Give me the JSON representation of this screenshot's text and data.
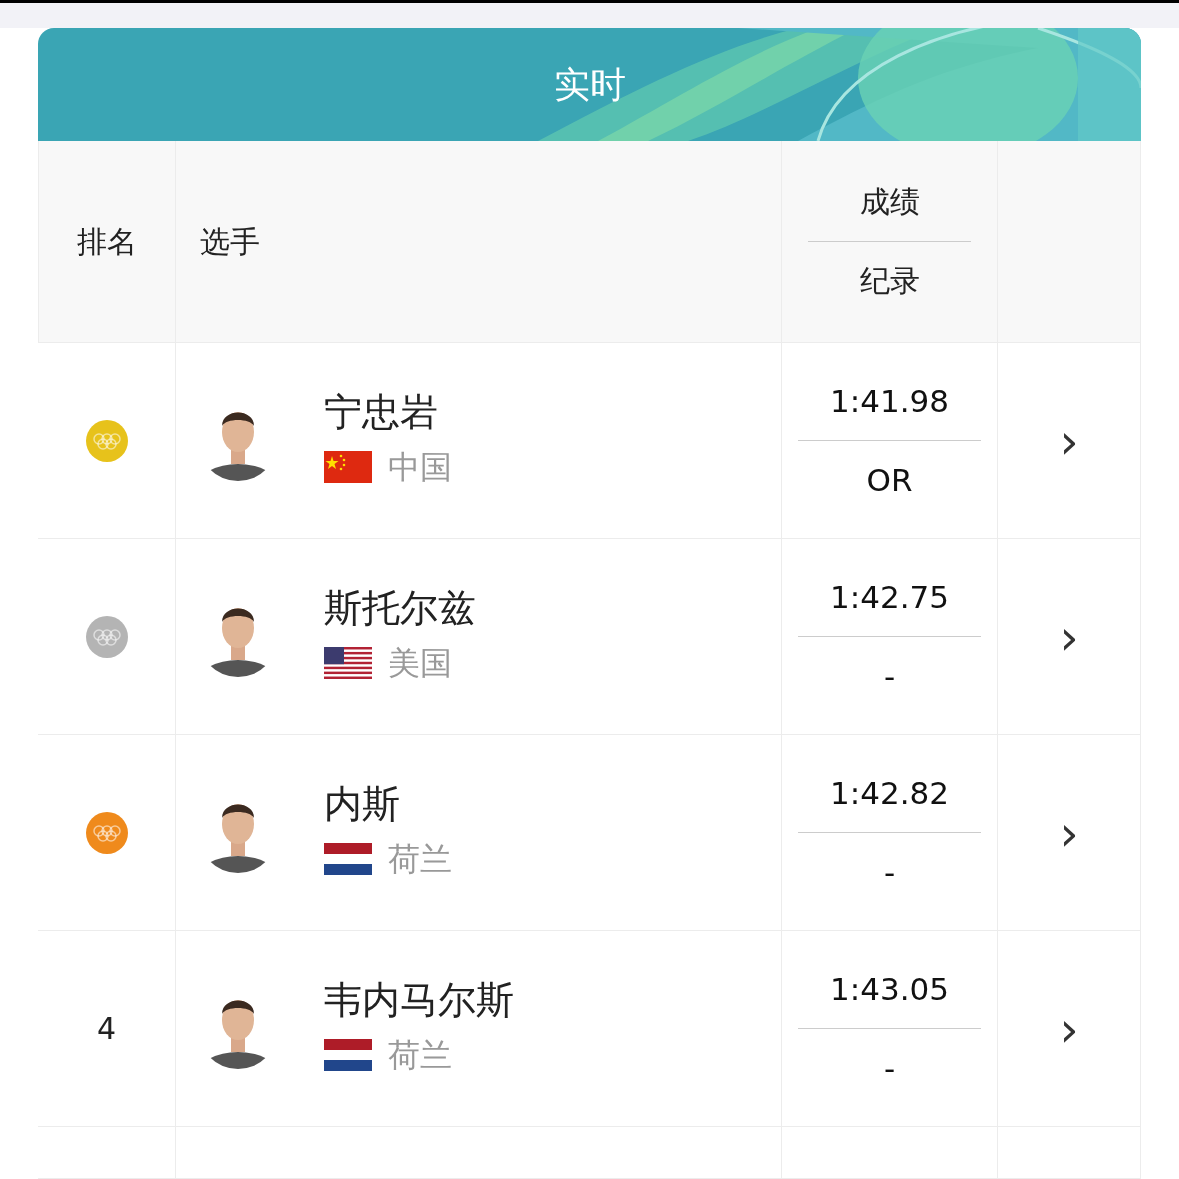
{
  "header": {
    "title": "实时"
  },
  "columns": [
    {
      "label": "排名"
    },
    {
      "label": "选手"
    },
    {
      "label": "成绩"
    },
    {
      "label": "纪录"
    }
  ],
  "rows": [
    {
      "kind": "medal",
      "color": "#e7c21b",
      "athlete": "宁忠岩",
      "flag": {
        "kind": "china"
      },
      "country": "中国",
      "time": "1:41.98",
      "record": "OR",
      "chevron": "›"
    },
    {
      "kind": "medal",
      "color": "#b4b4b4",
      "athlete": "斯托尔兹",
      "flag": {
        "kind": "usa"
      },
      "country": "美国",
      "time": "1:42.75",
      "record": "-",
      "chevron": "›"
    },
    {
      "kind": "medal",
      "color": "#ef8a1c",
      "athlete": "内斯",
      "flag": {
        "kind": "netherlands"
      },
      "country": "荷兰",
      "time": "1:42.82",
      "record": "-",
      "chevron": "›"
    },
    {
      "kind": "number",
      "rank": "4",
      "athlete": "韦内马尔斯",
      "flag": {
        "kind": "netherlands"
      },
      "country": "荷兰",
      "time": "1:43.05",
      "record": "-",
      "chevron": "›"
    }
  ]
}
